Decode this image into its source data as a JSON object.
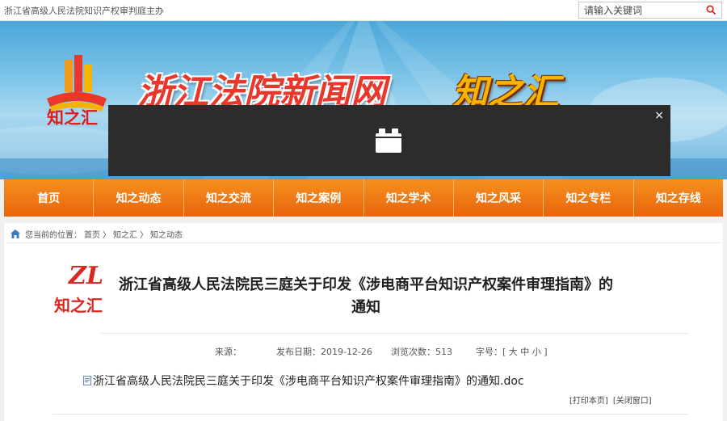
{
  "topbar": {
    "site_tagline": "浙江省高级人民法院知识产权审判庭主办",
    "search_placeholder": "请输入关键词"
  },
  "banner": {
    "logo_text": "知之汇",
    "title": "浙江法院新闻网",
    "title_suffix": "知之汇"
  },
  "overlay": {
    "close_label": "×"
  },
  "nav": {
    "items": [
      "首页",
      "知之动态",
      "知之交流",
      "知之案例",
      "知之学术",
      "知之风采",
      "知之专栏",
      "知之存线"
    ]
  },
  "breadcrumb": {
    "prefix": "您当前的位置：",
    "items": [
      "首页",
      "知之汇",
      "知之动态"
    ],
    "separator": "〉"
  },
  "article": {
    "logo_mark": "ZL",
    "logo_text": "知之汇",
    "title": "浙江省高级人民法院民三庭关于印发《涉电商平台知识产权案件审理指南》的通知",
    "source_label": "来源：",
    "date_label": "发布日期：2019-12-26",
    "views_label": "浏览次数：513",
    "font_size_label": "字号：[ 大 中 小 ]",
    "attachment": "浙江省高级人民法院民三庭关于印发《涉电商平台知识产权案件审理指南》的通知.doc",
    "print_label": "[打印本页]",
    "close_window_label": "[关闭窗口]"
  },
  "colors": {
    "nav_orange": "#ee7014",
    "title_red": "#e8382b",
    "title_gold": "#f5b400"
  }
}
